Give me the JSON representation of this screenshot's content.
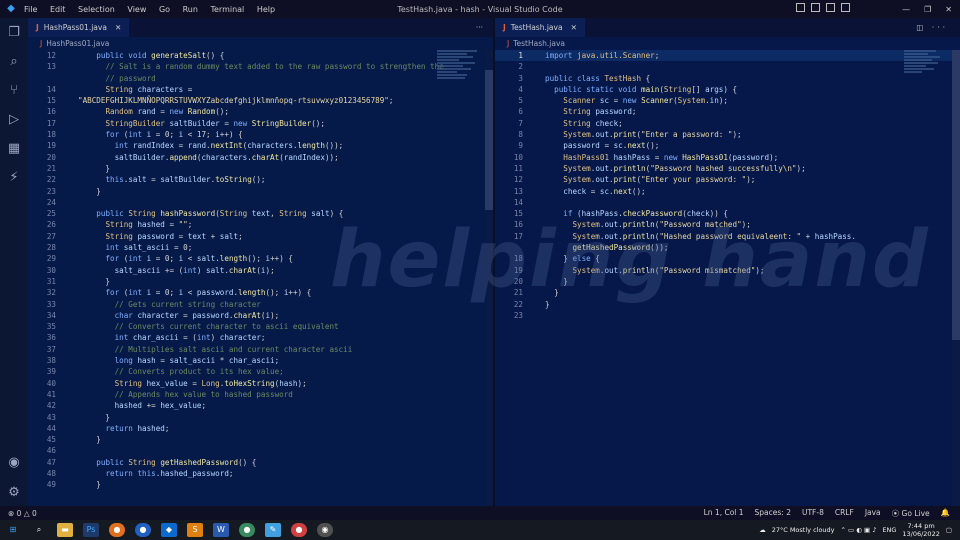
{
  "window": {
    "title": "TestHash.java - hash - Visual Studio Code",
    "menu": [
      "File",
      "Edit",
      "Selection",
      "View",
      "Go",
      "Run",
      "Terminal",
      "Help"
    ]
  },
  "left": {
    "tab": "HashPass01.java",
    "breadcrumb": "HashPass01.java",
    "lines": [
      {
        "n": "12",
        "h": "    <span class='kw'>public void</span> <span class='fn'>generateSalt</span>() {"
      },
      {
        "n": "13",
        "h": "      <span class='cm'>// Salt is a random dummy text added to the raw password to strengthen the</span>"
      },
      {
        "n": "",
        "h": "      <span class='cm'>// password</span>"
      },
      {
        "n": "14",
        "h": "      <span class='ty'>String</span> <span class='var'>characters</span> ="
      },
      {
        "n": "15",
        "h": "<span class='str'>\"ABCDEFGHIJKLMNÑOPQRRSTUVWXYZabcdefghijklmnñopq-rtsuvwxyz0123456789\"</span>;"
      },
      {
        "n": "16",
        "h": "      <span class='ty'>Random</span> <span class='var'>rand</span> = <span class='kw'>new</span> <span class='fn'>Random</span>();"
      },
      {
        "n": "17",
        "h": "      <span class='ty'>StringBuilder</span> <span class='var'>saltBuilder</span> = <span class='kw'>new</span> <span class='fn'>StringBuilder</span>();"
      },
      {
        "n": "18",
        "h": "      <span class='kw'>for</span> (<span class='kw'>int</span> <span class='var'>i</span> = 0; <span class='var'>i</span> &lt; 17; <span class='var'>i</span>++) {"
      },
      {
        "n": "19",
        "h": "        <span class='kw'>int</span> <span class='var'>randIndex</span> = <span class='var'>rand</span>.<span class='fn'>nextInt</span>(<span class='var'>characters</span>.<span class='fn'>length</span>());"
      },
      {
        "n": "20",
        "h": "        <span class='var'>saltBuilder</span>.<span class='fn'>append</span>(<span class='var'>characters</span>.<span class='fn'>charAt</span>(<span class='var'>randIndex</span>));"
      },
      {
        "n": "21",
        "h": "      }"
      },
      {
        "n": "22",
        "h": "      <span class='kw'>this</span>.<span class='var'>salt</span> = <span class='var'>saltBuilder</span>.<span class='fn'>toString</span>();"
      },
      {
        "n": "23",
        "h": "    }"
      },
      {
        "n": "24",
        "h": ""
      },
      {
        "n": "25",
        "h": "    <span class='kw'>public</span> <span class='ty'>String</span> <span class='fn'>hashPassword</span>(<span class='ty'>String</span> <span class='var'>text</span>, <span class='ty'>String</span> <span class='var'>salt</span>) {"
      },
      {
        "n": "26",
        "h": "      <span class='ty'>String</span> <span class='var'>hashed</span> = <span class='str'>\"\"</span>;"
      },
      {
        "n": "27",
        "h": "      <span class='ty'>String</span> <span class='var'>password</span> = <span class='var'>text</span> + <span class='var'>salt</span>;"
      },
      {
        "n": "28",
        "h": "      <span class='kw'>int</span> <span class='var'>salt_ascii</span> = 0;"
      },
      {
        "n": "29",
        "h": "      <span class='kw'>for</span> (<span class='kw'>int</span> <span class='var'>i</span> = 0; <span class='var'>i</span> &lt; <span class='var'>salt</span>.<span class='fn'>length</span>(); <span class='var'>i</span>++) {"
      },
      {
        "n": "30",
        "h": "        <span class='var'>salt_ascii</span> += (<span class='kw'>int</span>) <span class='var'>salt</span>.<span class='fn'>charAt</span>(<span class='var'>i</span>);"
      },
      {
        "n": "31",
        "h": "      }"
      },
      {
        "n": "32",
        "h": "      <span class='kw'>for</span> (<span class='kw'>int</span> <span class='var'>i</span> = 0; <span class='var'>i</span> &lt; <span class='var'>password</span>.<span class='fn'>length</span>(); <span class='var'>i</span>++) {"
      },
      {
        "n": "33",
        "h": "        <span class='cm'>// Gets current string character</span>"
      },
      {
        "n": "34",
        "h": "        <span class='kw'>char</span> <span class='var'>character</span> = <span class='var'>password</span>.<span class='fn'>charAt</span>(<span class='var'>i</span>);"
      },
      {
        "n": "35",
        "h": "        <span class='cm'>// Converts current character to ascii equivalent</span>"
      },
      {
        "n": "36",
        "h": "        <span class='kw'>int</span> <span class='var'>char_ascii</span> = (<span class='kw'>int</span>) <span class='var'>character</span>;"
      },
      {
        "n": "37",
        "h": "        <span class='cm'>// Multiplies salt ascii and current character ascii</span>"
      },
      {
        "n": "38",
        "h": "        <span class='kw'>long</span> <span class='var'>hash</span> = <span class='var'>salt_ascii</span> * <span class='var'>char_ascii</span>;"
      },
      {
        "n": "39",
        "h": "        <span class='cm'>// Converts product to its hex value;</span>"
      },
      {
        "n": "40",
        "h": "        <span class='ty'>String</span> <span class='var'>hex_value</span> = <span class='ty'>Long</span>.<span class='fn'>toHexString</span>(<span class='var'>hash</span>);"
      },
      {
        "n": "41",
        "h": "        <span class='cm'>// Appends hex value to hashed password</span>"
      },
      {
        "n": "42",
        "h": "        <span class='var'>hashed</span> += <span class='var'>hex_value</span>;"
      },
      {
        "n": "43",
        "h": "      }"
      },
      {
        "n": "44",
        "h": "      <span class='kw'>return</span> <span class='var'>hashed</span>;"
      },
      {
        "n": "45",
        "h": "    }"
      },
      {
        "n": "46",
        "h": ""
      },
      {
        "n": "47",
        "h": "    <span class='kw'>public</span> <span class='ty'>String</span> <span class='fn'>getHashedPassword</span>() {"
      },
      {
        "n": "48",
        "h": "      <span class='kw'>return this</span>.<span class='var'>hashed_password</span>;"
      },
      {
        "n": "49",
        "h": "    }"
      }
    ]
  },
  "right": {
    "tab": "TestHash.java",
    "breadcrumb": "TestHash.java",
    "lines": [
      {
        "n": "1",
        "h": "<span class='kw'>import</span> <span class='ty'>java.util.Scanner</span>;",
        "cur": true
      },
      {
        "n": "2",
        "h": ""
      },
      {
        "n": "3",
        "h": "<span class='kw'>public class</span> <span class='ty'>TestHash</span> {"
      },
      {
        "n": "4",
        "h": "  <span class='kw'>public static void</span> <span class='fn'>main</span>(<span class='ty'>String</span>[] <span class='var'>args</span>) {"
      },
      {
        "n": "5",
        "h": "    <span class='ty'>Scanner</span> <span class='var'>sc</span> = <span class='kw'>new</span> <span class='fn'>Scanner</span>(<span class='ty'>System</span>.<span class='var'>in</span>);"
      },
      {
        "n": "6",
        "h": "    <span class='ty'>String</span> <span class='var'>password</span>;"
      },
      {
        "n": "7",
        "h": "    <span class='ty'>String</span> <span class='var'>check</span>;"
      },
      {
        "n": "8",
        "h": "    <span class='ty'>System</span>.<span class='var'>out</span>.<span class='fn'>print</span>(<span class='str'>\"Enter a password: \"</span>);"
      },
      {
        "n": "9",
        "h": "    <span class='var'>password</span> = <span class='var'>sc</span>.<span class='fn'>next</span>();"
      },
      {
        "n": "10",
        "h": "    <span class='ty'>HashPass01</span> <span class='var'>hashPass</span> = <span class='kw'>new</span> <span class='fn'>HashPass01</span>(<span class='var'>password</span>);"
      },
      {
        "n": "11",
        "h": "    <span class='ty'>System</span>.<span class='var'>out</span>.<span class='fn'>println</span>(<span class='str'>\"Password hashed successfully\\n\"</span>);"
      },
      {
        "n": "12",
        "h": "    <span class='ty'>System</span>.<span class='var'>out</span>.<span class='fn'>print</span>(<span class='str'>\"Enter your password: \"</span>);"
      },
      {
        "n": "13",
        "h": "    <span class='var'>check</span> = <span class='var'>sc</span>.<span class='fn'>next</span>();"
      },
      {
        "n": "14",
        "h": ""
      },
      {
        "n": "15",
        "h": "    <span class='kw'>if</span> (<span class='var'>hashPass</span>.<span class='fn'>checkPassword</span>(<span class='var'>check</span>)) {"
      },
      {
        "n": "16",
        "h": "      <span class='ty'>System</span>.<span class='var'>out</span>.<span class='fn'>println</span>(<span class='str'>\"Password matched\"</span>);"
      },
      {
        "n": "17",
        "h": "      <span class='ty'>System</span>.<span class='var'>out</span>.<span class='fn'>println</span>(<span class='str'>\"Hashed password equivaleent: \"</span> + <span class='var'>hashPass</span>."
      },
      {
        "n": "",
        "h": "      <span class='fn'>getHashedPassword</span>());"
      },
      {
        "n": "18",
        "h": "    } <span class='kw'>else</span> {"
      },
      {
        "n": "19",
        "h": "      <span class='ty'>System</span>.<span class='var'>out</span>.<span class='fn'>println</span>(<span class='str'>\"Password mismatched\"</span>);"
      },
      {
        "n": "20",
        "h": "    }"
      },
      {
        "n": "21",
        "h": "  }"
      },
      {
        "n": "22",
        "h": "}"
      },
      {
        "n": "23",
        "h": ""
      }
    ]
  },
  "watermark": "helping hand",
  "status": {
    "errors": "0",
    "warnings": "0",
    "position": "Ln 1, Col 1",
    "spaces": "Spaces: 2",
    "encoding": "UTF-8",
    "eol": "CRLF",
    "lang": "Java",
    "live": "Go Live"
  },
  "taskbar": {
    "weather": "27°C  Mostly cloudy",
    "lang": "ENG",
    "time": "7:44 pm",
    "date": "13/06/2022"
  }
}
